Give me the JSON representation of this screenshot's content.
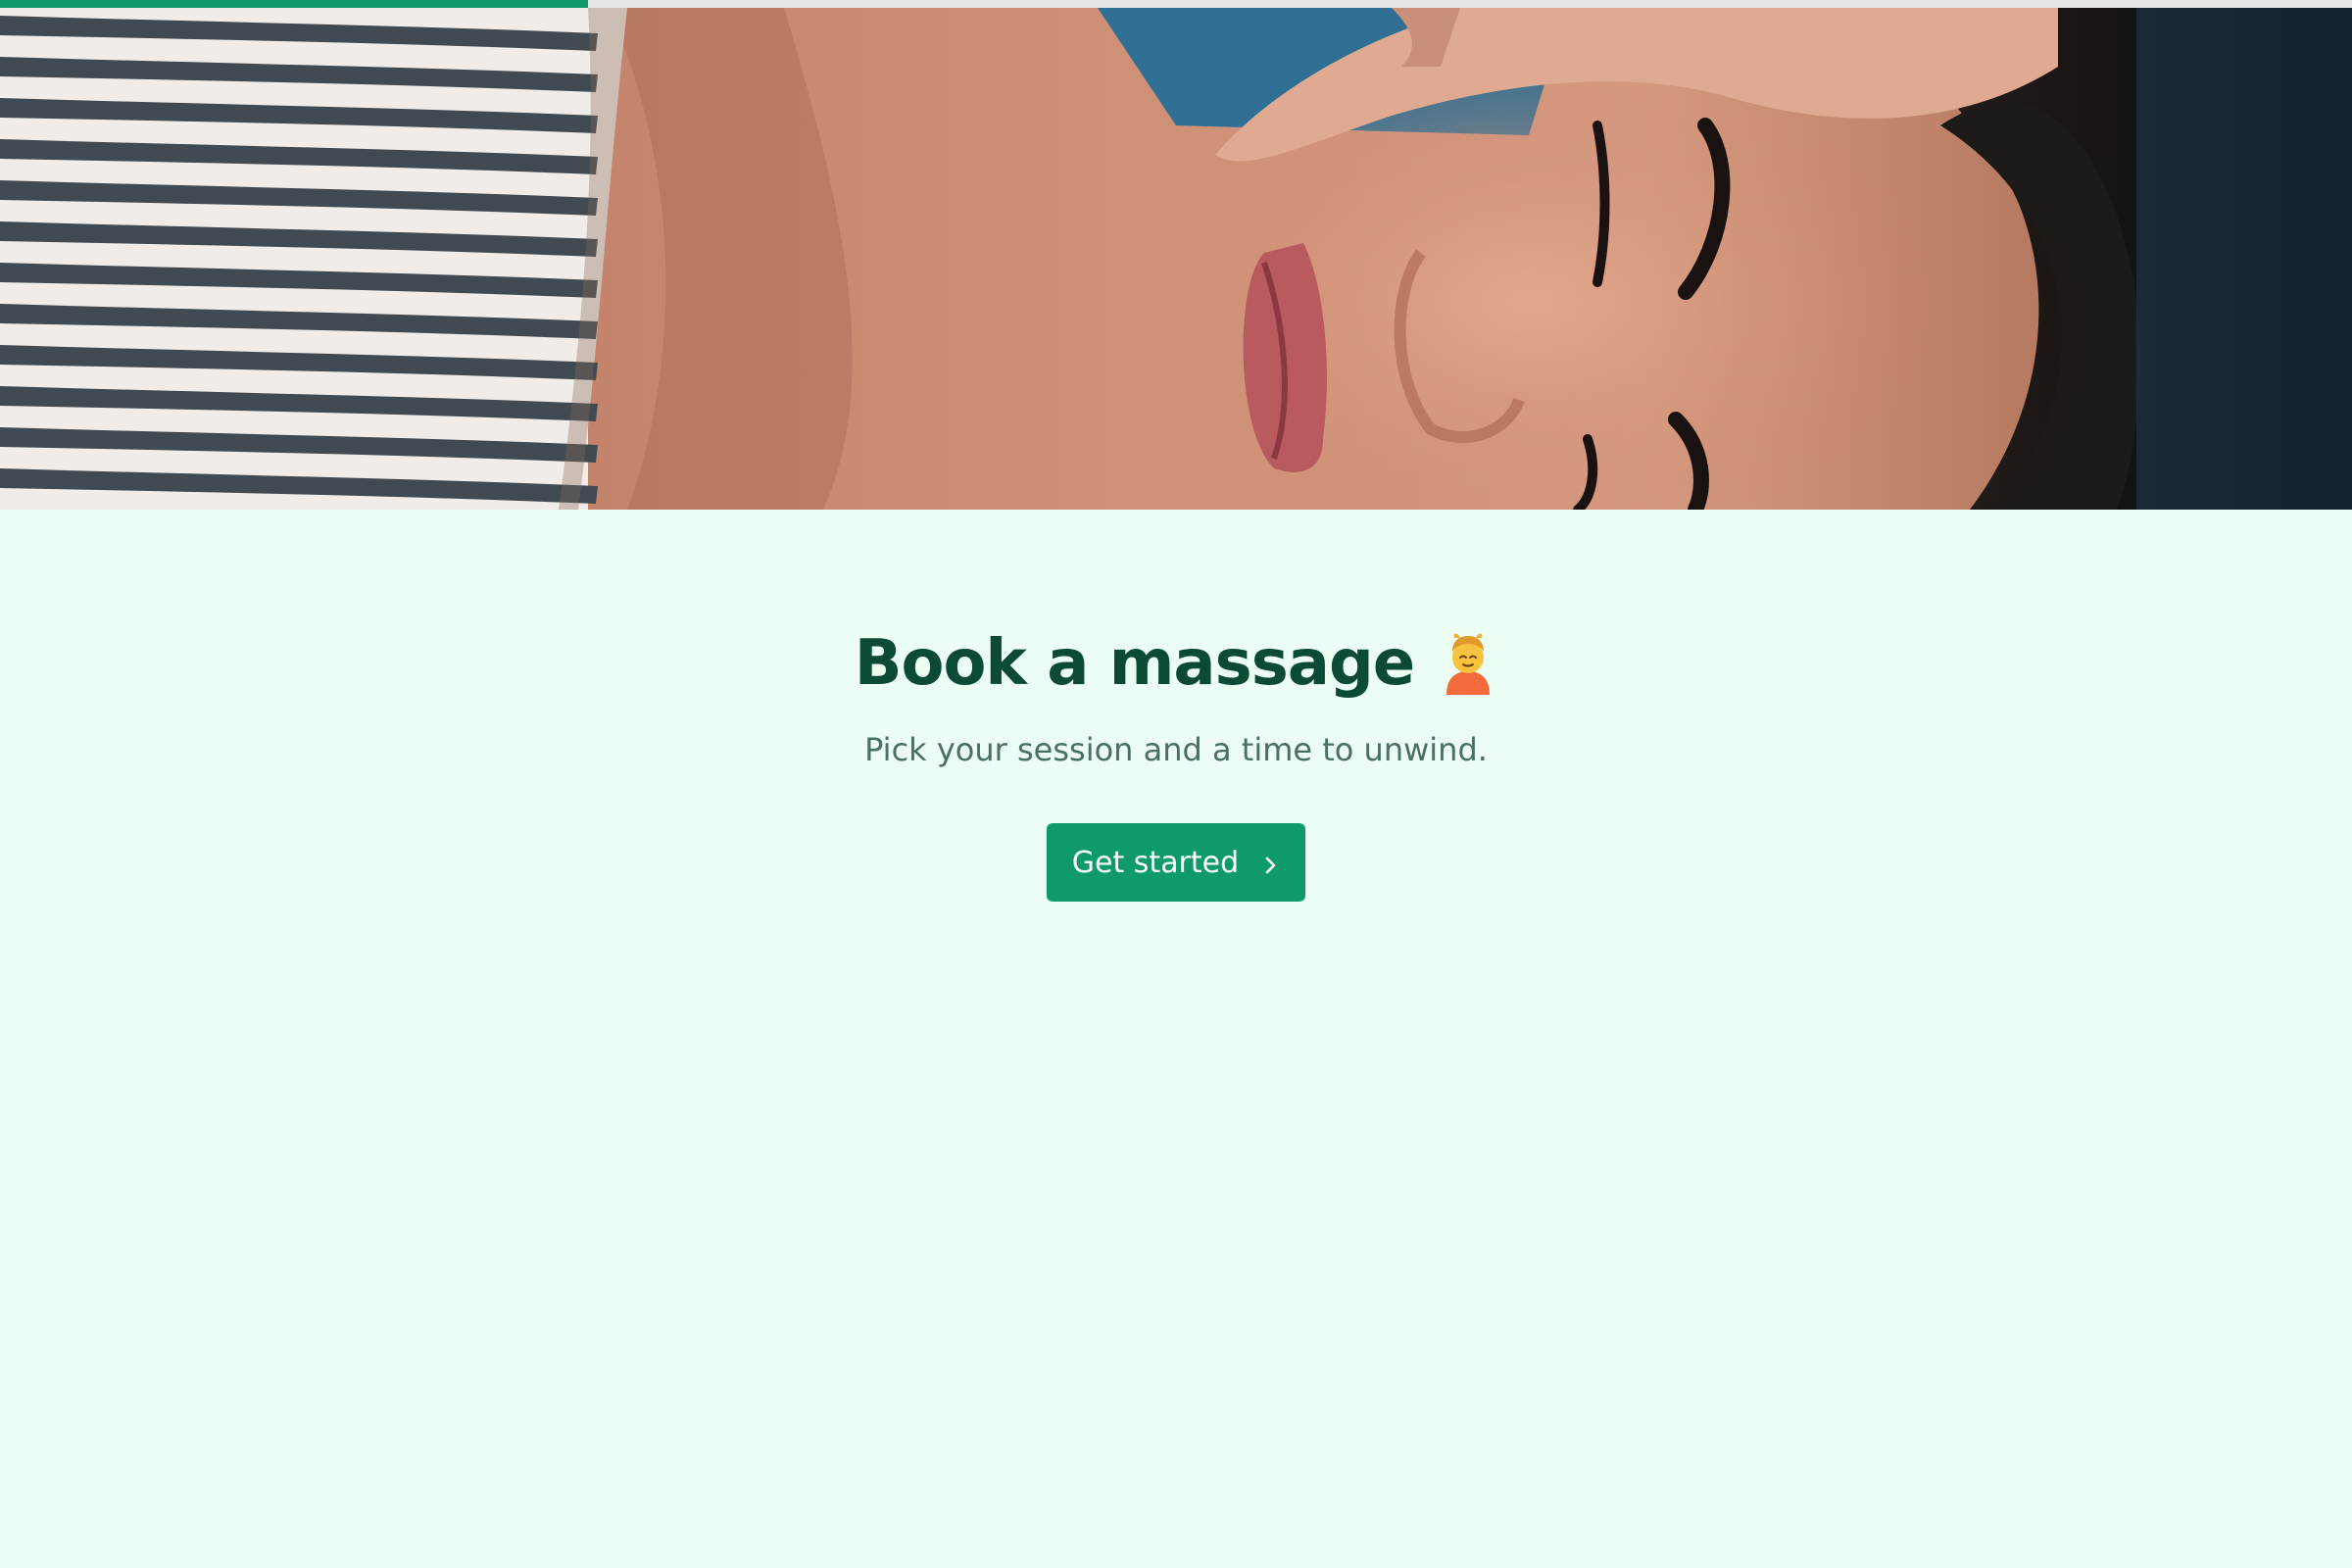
{
  "progress": {
    "fraction": 0.25
  },
  "hero": {
    "image": "person-receiving-face-massage-photo"
  },
  "main": {
    "title": "Book a massage",
    "title_icon": "person-getting-massage-emoji",
    "subtitle": "Pick your session and a time to unwind.",
    "cta_label": "Get started",
    "cta_icon": "chevron-right-icon"
  },
  "colors": {
    "accent": "#0f9a6a",
    "title": "#0b4a35",
    "subtitle": "#4a6f63",
    "background": "#ecfdf4"
  }
}
